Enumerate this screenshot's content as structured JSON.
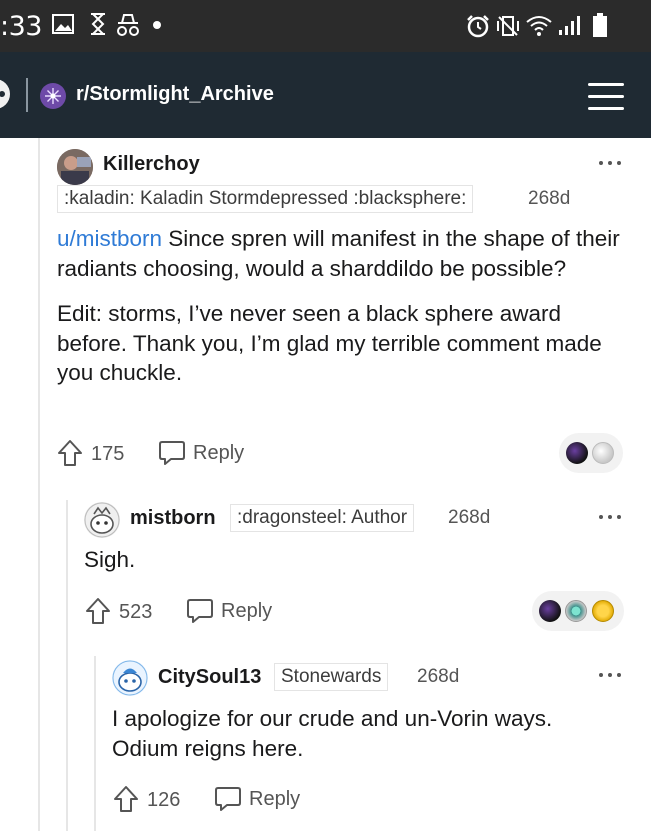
{
  "status_bar": {
    "time": ":33",
    "left_icons": [
      "image-icon",
      "hourglass-icon",
      "incognito-icon",
      "dot-icon"
    ],
    "right_icons": [
      "alarm-icon",
      "vibrate-icon",
      "wifi-icon",
      "signal-icon",
      "battery-icon"
    ]
  },
  "header": {
    "subreddit": "r/Stormlight_Archive",
    "menu_icon": "hamburger-menu-icon"
  },
  "comments": [
    {
      "username": "Killerchoy",
      "flair": ":kaladin: Kaladin Stormdepressed :blacksphere:",
      "age": "268d",
      "mention": "u/mistborn",
      "body_p1_rest": " Since spren will manifest in the shape of their radiants choosing, would a sharddildo be possible?",
      "body_p2": "Edit: storms, I’ve never seen a black sphere award before. Thank you, I’m glad my terrible comment made you chuckle.",
      "votes": "175",
      "reply_label": "Reply",
      "awards": [
        "black-sphere-award",
        "silver-award"
      ]
    },
    {
      "username": "mistborn",
      "flair": ":dragonsteel: Author",
      "age": "268d",
      "body": "Sigh.",
      "votes": "523",
      "reply_label": "Reply",
      "awards": [
        "black-sphere-award",
        "helpful-award",
        "gold-award"
      ]
    },
    {
      "username": "CitySoul13",
      "flair": "Stonewards",
      "age": "268d",
      "body": "I apologize for our crude and un-Vorin ways. Odium reigns here.",
      "votes": "126",
      "reply_label": "Reply"
    }
  ],
  "colors": {
    "status_bar": "#2b2b2b",
    "header": "#1f2a33",
    "link": "#2f7bd6",
    "text": "#1a1a1b",
    "meta": "#555555"
  }
}
